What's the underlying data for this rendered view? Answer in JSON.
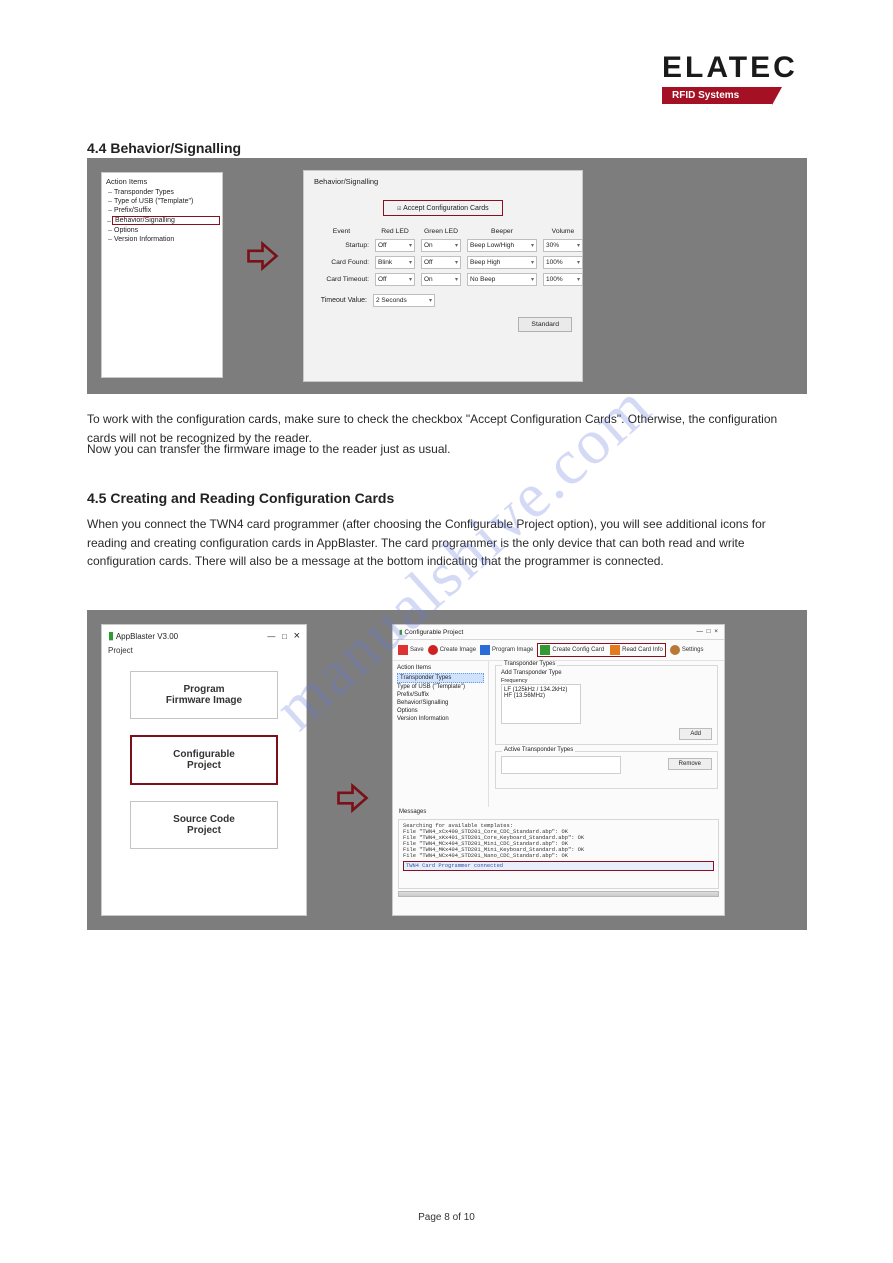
{
  "logo": {
    "brand": "ELATEC",
    "subtitle": "RFID Systems"
  },
  "section1_title": "4.4 Behavior/Signalling",
  "fig1": {
    "tree_title": "Action Items",
    "tree_items": [
      "Transponder Types",
      "Type of USB (\"Template\")",
      "Prefix/Suffix",
      "Behavior/Signalling",
      "Options",
      "Version Information"
    ],
    "behav_title": "Behavior/Signalling",
    "accept_label": "Accept Configuration Cards",
    "col_headers": {
      "event": "Event",
      "red": "Red LED",
      "green": "Green LED",
      "beeper": "Beeper",
      "volume": "Volume"
    },
    "rows": {
      "startup": {
        "label": "Startup:",
        "red": "Off",
        "green": "On",
        "beeper": "Beep Low/High",
        "volume": "30%"
      },
      "card_found": {
        "label": "Card Found:",
        "red": "Blink",
        "green": "Off",
        "beeper": "Beep High",
        "volume": "100%"
      },
      "card_timeout": {
        "label": "Card Timeout:",
        "red": "Off",
        "green": "On",
        "beeper": "No Beep",
        "volume": "100%"
      },
      "timeout_value": {
        "label": "Timeout Value:",
        "value": "2 Seconds"
      }
    },
    "standard_btn": "Standard"
  },
  "para1": "To work with the configuration cards, make sure to check the checkbox \"Accept Configuration Cards\". Otherwise, the configuration cards will not be recognized by the reader.",
  "para2": "Now you can transfer the firmware image to the reader just as usual.",
  "section2_title": "4.5 Creating and Reading Configuration Cards",
  "para3": "When you connect the TWN4 card programmer (after choosing the Configurable Project option), you will see additional icons for reading and creating configuration cards in AppBlaster. The card programmer is the only device that can both read and write configuration cards. There will also be a message at the bottom indicating that the programmer is connected.",
  "fig2": {
    "appblaster": {
      "title": "AppBlaster V3.00",
      "menu": "Project",
      "buttons": {
        "program": "Program\nFirmware Image",
        "configurable": "Configurable\nProject",
        "sourcecode": "Source Code\nProject"
      }
    },
    "cfgwindow": {
      "title": "Configurable Project",
      "toolbar": {
        "save": "Save",
        "create_image": "Create Image",
        "program_image": "Program Image",
        "create_config": "Create Config Card",
        "read_card": "Read Card Info",
        "settings": "Settings"
      },
      "left_title": "Action Items",
      "left_items": [
        "Transponder Types",
        "Type of USB (\"Template\")",
        "Prefix/Suffix",
        "Behavior/Signalling",
        "Options",
        "Version Information"
      ],
      "right": {
        "group1": "Transponder Types",
        "add_label": "Add Transponder Type",
        "freq_label": "Frequency",
        "freq_items": [
          "LF (125kHz / 134.2kHz)",
          "HF (13.56MHz)"
        ],
        "add_btn": "Add",
        "group2": "Active Transponder Types",
        "remove_btn": "Remove"
      },
      "messages_title": "Messages",
      "messages": [
        "Searching for available templates:",
        "File \"TWN4_xCx400_STD201_Core_CDC_Standard.abp\": OK",
        "File \"TWN4_xKx401_STD201_Core_Keyboard_Standard.abp\": OK",
        "File \"TWN4_MCx404_STD201_Mini_CDC_Standard.abp\": OK",
        "File \"TWN4_MKx404_STD201_Mini_Keyboard_Standard.abp\": OK",
        "File \"TWN4_NCx404_STD201_Nano_CDC_Standard.abp\": OK"
      ],
      "messages_highlight": "TWN4 Card Programmer connected"
    }
  },
  "footer_page": "Page 8 of 10",
  "watermark": "manualshive.com"
}
